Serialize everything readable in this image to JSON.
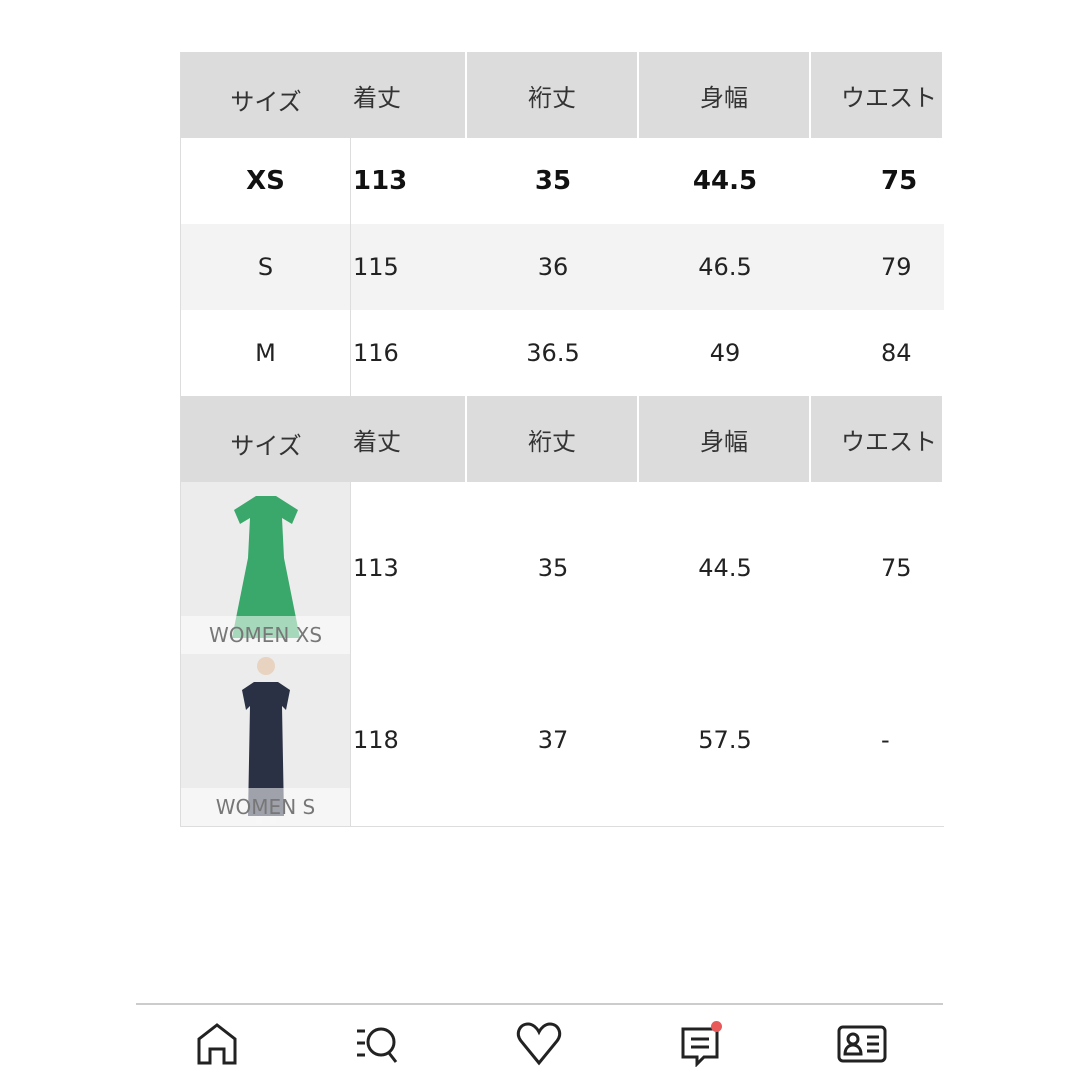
{
  "headers": [
    "サイズ",
    "着丈",
    "裄丈",
    "身幅",
    "ウエスト"
  ],
  "size_rows": [
    {
      "size": "XS",
      "values": [
        "113",
        "35",
        "44.5",
        "75"
      ]
    },
    {
      "size": "S",
      "values": [
        "115",
        "36",
        "46.5",
        "79"
      ]
    },
    {
      "size": "M",
      "values": [
        "116",
        "36.5",
        "49",
        "84"
      ]
    }
  ],
  "model_rows": [
    {
      "label": "WOMEN XS",
      "values": [
        "113",
        "35",
        "44.5",
        "75"
      ],
      "dress_color": "#3aa86a"
    },
    {
      "label": "WOMEN S",
      "values": [
        "118",
        "37",
        "57.5",
        "-"
      ],
      "dress_color": "#2a3145"
    }
  ],
  "nav": {
    "items": [
      "home-icon",
      "search-icon",
      "heart-icon",
      "chat-icon",
      "member-card-icon"
    ],
    "badge_color": "#e85a5a"
  }
}
